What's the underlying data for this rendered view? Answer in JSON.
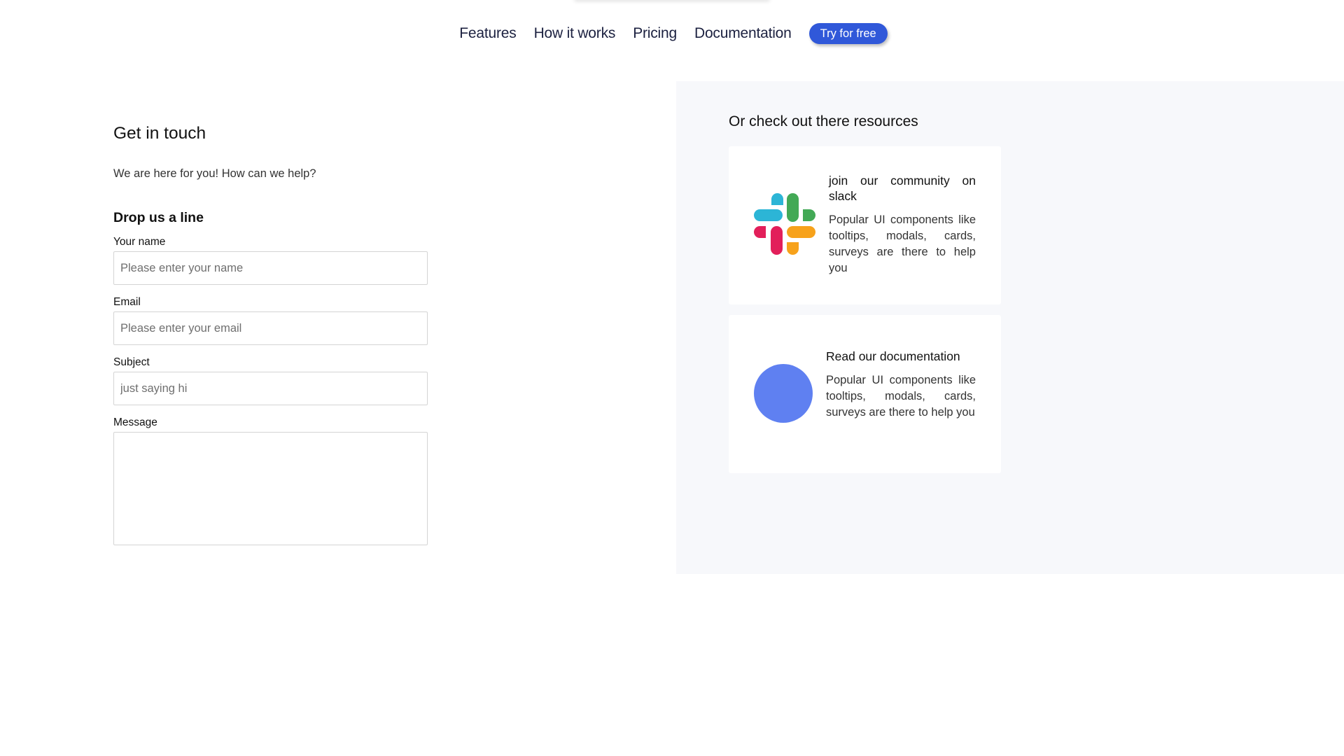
{
  "nav": {
    "links": [
      "Features",
      "How it works",
      "Pricing",
      "Documentation"
    ],
    "cta_label": "Try for free",
    "cta_color": "#3058d9"
  },
  "contact": {
    "title": "Get in touch",
    "subtitle": "We are here for you! How can we help?",
    "form_title": "Drop us a line",
    "fields": {
      "name": {
        "label": "Your name",
        "placeholder": "Please enter your name"
      },
      "email": {
        "label": "Email",
        "placeholder": "Please enter your email"
      },
      "subject": {
        "label": "Subject",
        "placeholder": "just saying hi"
      },
      "message": {
        "label": "Message",
        "placeholder": ""
      }
    }
  },
  "resources": {
    "title": "Or check out there resources",
    "panel_color": "#f7f8fb",
    "cards": [
      {
        "icon": "slack-logo-icon",
        "heading": "join our community on slack",
        "description": "Popular UI components like tooltips, modals, cards, surveys are there to help you"
      },
      {
        "icon": "documentation-circle-icon",
        "icon_color": "#5f80f1",
        "heading": "Read our documentation",
        "description": "Popular UI components like tooltips, modals, cards, surveys are there to help you"
      }
    ]
  }
}
